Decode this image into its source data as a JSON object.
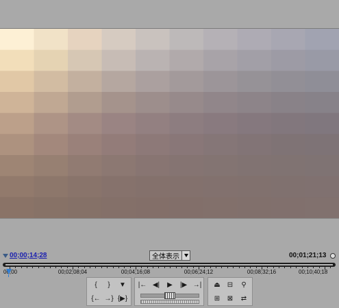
{
  "monitor": {
    "current_timecode": "00;00;14;28",
    "duration_timecode": "00;01;21;13",
    "zoom_label": "全体表示"
  },
  "ruler": {
    "labels": [
      "00;00",
      "00;02;08;04",
      "00;04;16;08",
      "00;06;24;12",
      "00;08;32;16",
      "00;10;40;18"
    ]
  },
  "mosaic": {
    "rows": [
      [
        "#fdf0d5",
        "#f1e2c7",
        "#e6d3bf",
        "#d6cbc1",
        "#c9c2be",
        "#bdb9b9",
        "#b5b1b6",
        "#aeabb4",
        "#a8a7b2",
        "#a1a3b1"
      ],
      [
        "#f2deba",
        "#e5d3b3",
        "#d6c7b4",
        "#c7bcb5",
        "#bab3b2",
        "#b1aaab",
        "#a8a3a8",
        "#a29fa7",
        "#9d9ba5",
        "#999aa6"
      ],
      [
        "#e1c8a6",
        "#d2bca2",
        "#c3b09f",
        "#b5a7a0",
        "#aba09f",
        "#a39a9b",
        "#9c9599",
        "#969297",
        "#928f96",
        "#8f8e97"
      ],
      [
        "#cfb498",
        "#c0a893",
        "#b19d8f",
        "#a5938c",
        "#9d8e8c",
        "#978a8b",
        "#91868a",
        "#8d8489",
        "#898288",
        "#878289"
      ],
      [
        "#bca08a",
        "#ae9486",
        "#a38b84",
        "#9a8483",
        "#938081",
        "#8d7d80",
        "#897a7f",
        "#85787e",
        "#82777d",
        "#80777e"
      ],
      [
        "#ad927f",
        "#a3887c",
        "#9a817a",
        "#937c79",
        "#8d7978",
        "#897778",
        "#857677",
        "#827476",
        "#7f7375",
        "#7e7376"
      ],
      [
        "#9e8574",
        "#978072",
        "#917b72",
        "#8c7872",
        "#887572",
        "#857472",
        "#837472",
        "#817372",
        "#807372",
        "#7f7373"
      ],
      [
        "#927a6c",
        "#8d776b",
        "#89746b",
        "#86726c",
        "#84716c",
        "#83716d",
        "#82716e",
        "#81716e",
        "#80716f",
        "#807170"
      ],
      [
        "#8a7367",
        "#877267",
        "#857168",
        "#847069",
        "#836f69",
        "#826f6a",
        "#82706b",
        "#81706c",
        "#81706d",
        "#81716e"
      ]
    ]
  },
  "controls": {
    "markers": [
      {
        "id": "set-in",
        "glyph": "{"
      },
      {
        "id": "set-out",
        "glyph": "}"
      },
      {
        "id": "set-marker",
        "glyph": "▼"
      },
      {
        "id": "goto-in",
        "glyph": "{←"
      },
      {
        "id": "goto-out",
        "glyph": "→}"
      },
      {
        "id": "play-in-out",
        "glyph": "{▶}"
      }
    ],
    "transport": [
      {
        "id": "prev-edit",
        "glyph": "|←"
      },
      {
        "id": "step-back",
        "glyph": "◀|"
      },
      {
        "id": "play",
        "glyph": "▶"
      },
      {
        "id": "step-forward",
        "glyph": "|▶"
      },
      {
        "id": "next-edit",
        "glyph": "→|"
      }
    ],
    "edit": [
      {
        "id": "lift",
        "glyph": "⏏"
      },
      {
        "id": "extract",
        "glyph": "⊟"
      },
      {
        "id": "export-frame",
        "glyph": "⚲"
      },
      {
        "id": "insert",
        "glyph": "⊞"
      },
      {
        "id": "overlay",
        "glyph": "⊠"
      },
      {
        "id": "trim",
        "glyph": "⇄"
      }
    ]
  }
}
